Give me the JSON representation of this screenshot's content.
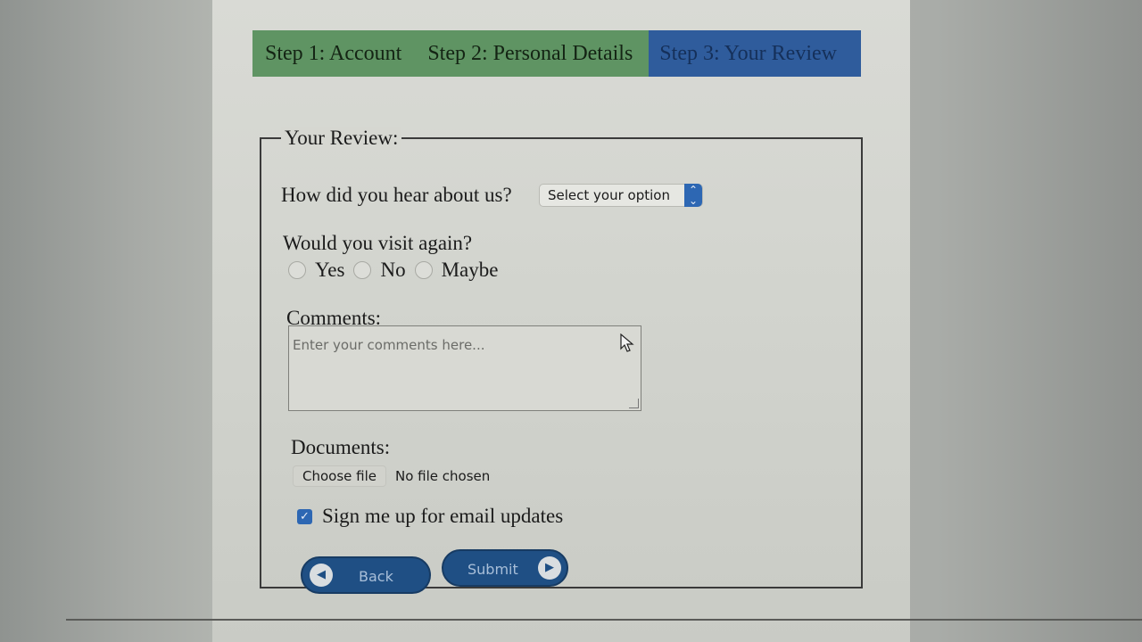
{
  "steps": [
    {
      "label": "Step 1: Account",
      "state": "done"
    },
    {
      "label": "Step 2: Personal Details",
      "state": "done"
    },
    {
      "label": "Step 3: Your Review",
      "state": "active"
    }
  ],
  "form": {
    "legend": "Your Review:",
    "hear_about": {
      "label": "How did you hear about us?",
      "selected": "Select your option"
    },
    "visit_again": {
      "label": "Would you visit again?",
      "options": [
        "Yes",
        "No",
        "Maybe"
      ]
    },
    "comments": {
      "label": "Comments:",
      "placeholder": "Enter your comments here..."
    },
    "documents": {
      "label": "Documents:",
      "button": "Choose file",
      "status": "No file chosen"
    },
    "email_updates": {
      "label": "Sign me up for email updates",
      "checked": true
    },
    "buttons": {
      "back": "Back",
      "submit": "Submit"
    }
  },
  "colors": {
    "step_done": "#5f9463",
    "step_active": "#2f5c9c",
    "button": "#1f4f84",
    "accent": "#2d67b3"
  }
}
